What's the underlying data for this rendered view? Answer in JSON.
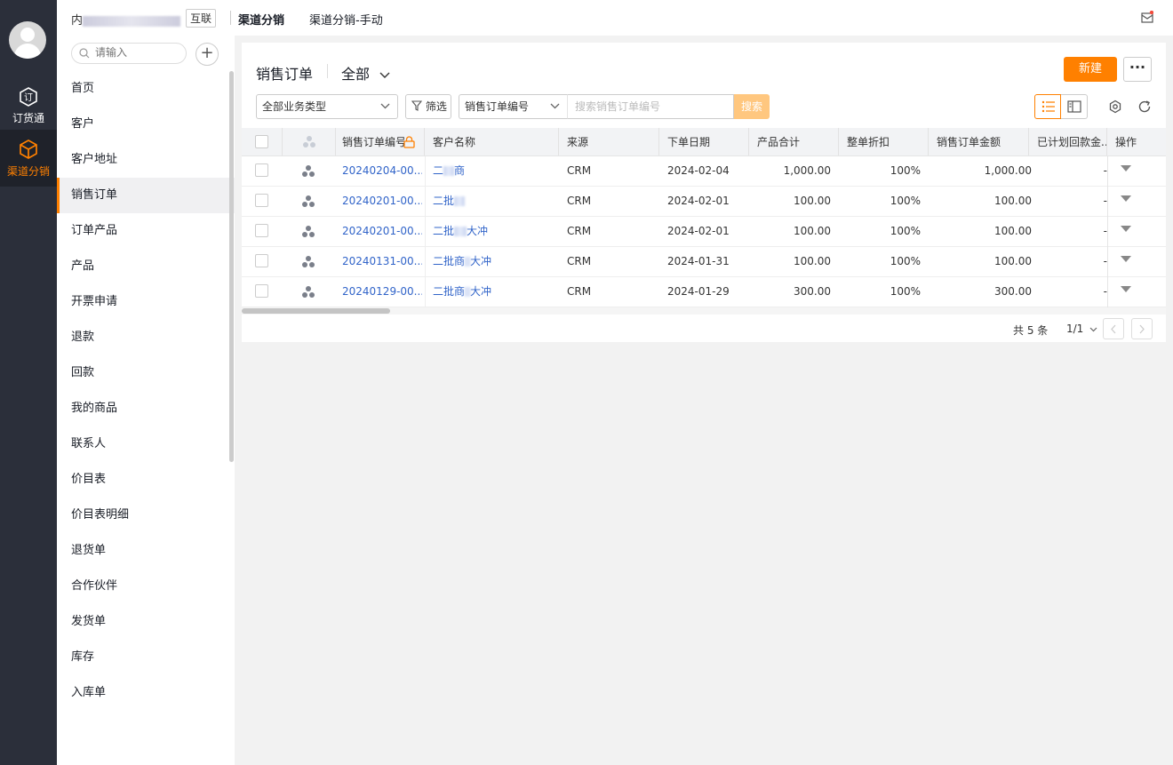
{
  "rail": {
    "items": [
      {
        "label": "订货通",
        "icon": "order-box-icon"
      },
      {
        "label": "渠道分销",
        "icon": "cube-icon"
      }
    ]
  },
  "topbar": {
    "org_prefix": "内",
    "tag": "互联",
    "crumbs": [
      "渠道分销",
      "渠道分销-手动"
    ]
  },
  "menu": {
    "search_placeholder": "请输入",
    "items": [
      "首页",
      "客户",
      "客户地址",
      "销售订单",
      "订单产品",
      "产品",
      "开票申请",
      "退款",
      "回款",
      "我的商品",
      "联系人",
      "价目表",
      "价目表明细",
      "退货单",
      "合作伙伴",
      "发货单",
      "库存",
      "入库单"
    ],
    "active_index": 3
  },
  "main": {
    "title": "销售订单",
    "scope": "全部",
    "new_label": "新建",
    "more_label": "···",
    "biz_type": "全部业务类型",
    "filter_label": "筛选",
    "search_field": "销售订单编号",
    "search_placeholder": "搜索销售订单编号",
    "search_label": "搜索"
  },
  "table": {
    "columns": [
      "销售订单编号",
      "客户名称",
      "来源",
      "下单日期",
      "产品合计",
      "整单折扣",
      "销售订单金额",
      "已计划回款金...",
      "操作"
    ],
    "rows": [
      {
        "id": "20240204-00...",
        "cust_a": "二",
        "cust_b": "商",
        "source": "CRM",
        "date": "2024-02-04",
        "total": "1,000.00",
        "discount": "100%",
        "amount": "1,000.00",
        "planned": "-"
      },
      {
        "id": "20240201-00...",
        "cust_a": "二批",
        "cust_b": "",
        "source": "CRM",
        "date": "2024-02-01",
        "total": "100.00",
        "discount": "100%",
        "amount": "100.00",
        "planned": "-"
      },
      {
        "id": "20240201-00...",
        "cust_a": "二批",
        "cust_b": "大冲",
        "source": "CRM",
        "date": "2024-02-01",
        "total": "100.00",
        "discount": "100%",
        "amount": "100.00",
        "planned": "-"
      },
      {
        "id": "20240131-00...",
        "cust_a": "二批商",
        "cust_b": "大冲",
        "source": "CRM",
        "date": "2024-01-31",
        "total": "100.00",
        "discount": "100%",
        "amount": "100.00",
        "planned": "-"
      },
      {
        "id": "20240129-00...",
        "cust_a": "二批商",
        "cust_b": "大冲",
        "source": "CRM",
        "date": "2024-01-29",
        "total": "300.00",
        "discount": "100%",
        "amount": "300.00",
        "planned": "-"
      }
    ]
  },
  "pager": {
    "total": "共 5 条",
    "page": "1/1"
  },
  "colors": {
    "accent": "#ff8000",
    "link": "#3164c9",
    "rail": "#2b2f3a"
  }
}
